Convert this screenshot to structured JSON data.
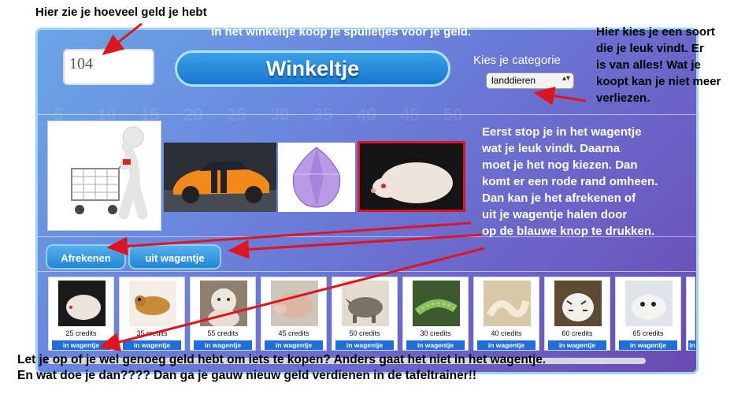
{
  "app": {
    "money": "104",
    "title": "Winkeltje",
    "category_label": "Kies je categorie",
    "category_selected": "landdieren",
    "buttons": {
      "checkout": "Afrekenen",
      "remove": "uit wagentje"
    }
  },
  "shop_items": [
    {
      "price": "25 credits",
      "add_label": "in wagentje",
      "icon": "hedgehog-photo"
    },
    {
      "price": "35 credits",
      "add_label": "in wagentje",
      "icon": "gecko-photo"
    },
    {
      "price": "55 credits",
      "add_label": "in wagentje",
      "icon": "white-gorilla-photo"
    },
    {
      "price": "45 credits",
      "add_label": "in wagentje",
      "icon": "armadillo-photo"
    },
    {
      "price": "50 credits",
      "add_label": "in wagentje",
      "icon": "rhino-photo"
    },
    {
      "price": "30 credits",
      "add_label": "in wagentje",
      "icon": "caterpillar-photo"
    },
    {
      "price": "40 credits",
      "add_label": "in wagentje",
      "icon": "white-snake-photo"
    },
    {
      "price": "60 credits",
      "add_label": "in wagentje",
      "icon": "white-tiger-photo"
    },
    {
      "price": "65 credits",
      "add_label": "in wagentje",
      "icon": "seal-pup-photo"
    },
    {
      "price": "",
      "add_label": "in",
      "icon": "partial-item"
    }
  ],
  "cart_items": [
    {
      "icon": "orange-sports-car-photo"
    },
    {
      "icon": "purple-gem-photo"
    },
    {
      "icon": "hedgehog-photo",
      "selected": true
    }
  ],
  "annotations": {
    "money_note": "Hier zie je hoeveel geld je hebt",
    "intro_note": "In het winkeltje koop je spulletjes voor je geld.",
    "category_note": [
      "Hier kies je een soort",
      "die je leuk vindt. Er",
      "is van alles! Wat je",
      "koopt kan je niet meer",
      "verliezen."
    ],
    "cart_note": [
      "Eerst stop je in het wagentje",
      "wat je leuk vindt.  Daarna",
      "moet je het nog kiezen. Dan",
      "komt er een rode rand omheen.",
      "Dan kan je het afrekenen of",
      " uit je wagentje halen door",
      "op de blauwe knop te drukken."
    ],
    "footer_note": [
      "Let je op of je wel genoeg geld hebt om iets te kopen? Anders gaat het niet in het wagentje.",
      "En wat doe je dan???? Dan ga je gauw nieuw geld verdienen in de tafeltrainer!!"
    ]
  },
  "colors": {
    "accent_blue": "#1f86d6",
    "arrow_red": "#e0141e",
    "selected_border": "#e0141e"
  }
}
